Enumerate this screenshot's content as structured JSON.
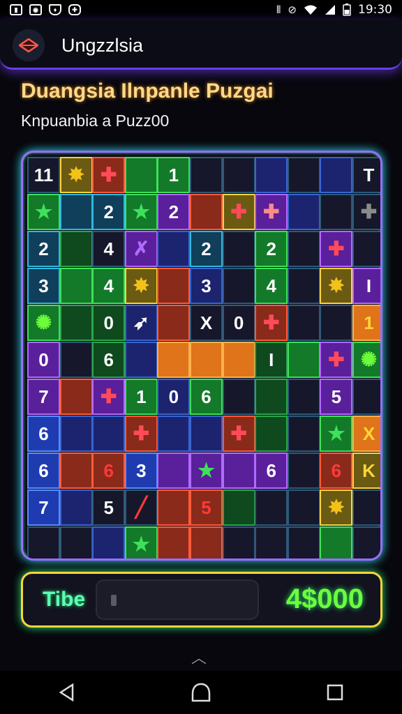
{
  "status": {
    "time": "19:30",
    "left_icons": [
      "signal-icon",
      "photo-icon",
      "shield-icon",
      "gamepad-icon"
    ],
    "right_icons": [
      "vibrate-icon",
      "no-signal-icon",
      "wifi-icon",
      "cell-signal-icon",
      "battery-icon"
    ]
  },
  "appbar": {
    "title": "Ungzzlsia",
    "logo": "diamond-logo-icon"
  },
  "header": {
    "title": "Duangsia Ilnpanle Puzgai",
    "subtitle": "Knpuanbia a Puzz00"
  },
  "board": {
    "colors": {
      "accent": "#9f6bff",
      "glow": "#34e3ff",
      "green": "#3fe05a",
      "orange": "#e0741a",
      "red": "#ff5a3a"
    },
    "labels": {
      "r0c0": "11",
      "r0c4": "1",
      "r0c10": "T",
      "r1c2": "2",
      "r1c4": "2",
      "r2c0": "2",
      "r2c2": "4",
      "r2c5": "2",
      "r2c7": "2",
      "r3c0": "3",
      "r3c2": "4",
      "r3c5": "3",
      "r3c7": "4",
      "r3c10": "I",
      "r4c2": "0",
      "r4c5": "X",
      "r4c6": "0",
      "r4c10": "1",
      "r5c0": "0",
      "r5c2": "6",
      "r5c7": "I",
      "r6c0": "7",
      "r6c3": "1",
      "r6c4": "0",
      "r6c5": "6",
      "r6c9": "5",
      "r7c0": "6",
      "r7c10": "X",
      "r8c0": "6",
      "r8c2": "6",
      "r8c3": "3",
      "r8c7": "6",
      "r8c9": "6",
      "r8c10": "K",
      "r9c0": "7",
      "r9c2": "5",
      "r9c5": "5"
    },
    "icons": {
      "r0c1": "gold-star-icon",
      "r0c2": "red-puzzle-icon",
      "r1c0": "green-star-icon",
      "r1c3": "green-star-icon",
      "r1c6": "red-puzzle-icon",
      "r1c7": "puzzle-piece-icon",
      "r1c10": "gray-puzzle-icon",
      "r2c3": "cross-icon",
      "r2c9": "red-puzzle-icon",
      "r3c3": "gold-star-icon",
      "r3c9": "gold-star-icon",
      "r4c0": "green-splat-icon",
      "r4c3": "arrow-icon",
      "r4c7": "red-puzzle-icon",
      "r5c9": "red-puzzle-icon",
      "r5c10": "green-splat-icon",
      "r6c2": "red-puzzle-icon",
      "r7c3": "red-puzzle-icon",
      "r7c6": "red-puzzle-icon",
      "r7c9": "green-star-icon",
      "r8c5": "green-star-icon",
      "r9c3": "slash-icon",
      "r9c9": "gold-star-icon",
      "r10c3": "green-star-icon"
    }
  },
  "timer": {
    "label": "Tibe",
    "score": "4$000",
    "progress": 0.02
  },
  "nav": {
    "back": "back-icon",
    "home": "home-icon",
    "recents": "recents-icon"
  }
}
